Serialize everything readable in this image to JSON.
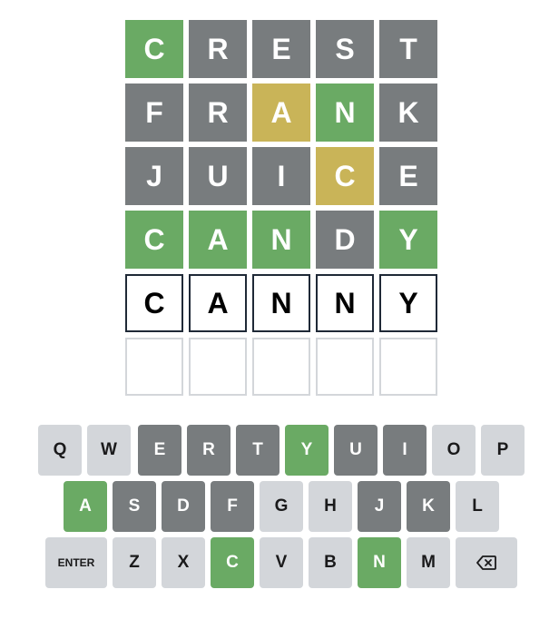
{
  "board": {
    "rows": [
      [
        {
          "letter": "C",
          "state": "correct"
        },
        {
          "letter": "R",
          "state": "absent"
        },
        {
          "letter": "E",
          "state": "absent"
        },
        {
          "letter": "S",
          "state": "absent"
        },
        {
          "letter": "T",
          "state": "absent"
        }
      ],
      [
        {
          "letter": "F",
          "state": "absent"
        },
        {
          "letter": "R",
          "state": "absent"
        },
        {
          "letter": "A",
          "state": "present"
        },
        {
          "letter": "N",
          "state": "correct"
        },
        {
          "letter": "K",
          "state": "absent"
        }
      ],
      [
        {
          "letter": "J",
          "state": "absent"
        },
        {
          "letter": "U",
          "state": "absent"
        },
        {
          "letter": "I",
          "state": "absent"
        },
        {
          "letter": "C",
          "state": "present"
        },
        {
          "letter": "E",
          "state": "absent"
        }
      ],
      [
        {
          "letter": "C",
          "state": "correct"
        },
        {
          "letter": "A",
          "state": "correct"
        },
        {
          "letter": "N",
          "state": "correct"
        },
        {
          "letter": "D",
          "state": "absent"
        },
        {
          "letter": "Y",
          "state": "correct"
        }
      ],
      [
        {
          "letter": "C",
          "state": "tbd"
        },
        {
          "letter": "A",
          "state": "tbd"
        },
        {
          "letter": "N",
          "state": "tbd"
        },
        {
          "letter": "N",
          "state": "tbd"
        },
        {
          "letter": "Y",
          "state": "tbd"
        }
      ],
      [
        {
          "letter": "",
          "state": "empty"
        },
        {
          "letter": "",
          "state": "empty"
        },
        {
          "letter": "",
          "state": "empty"
        },
        {
          "letter": "",
          "state": "empty"
        },
        {
          "letter": "",
          "state": "empty"
        }
      ]
    ]
  },
  "keyboard": {
    "rows": [
      [
        {
          "label": "Q",
          "state": "default"
        },
        {
          "label": "W",
          "state": "default"
        },
        {
          "label": "E",
          "state": "absent"
        },
        {
          "label": "R",
          "state": "absent"
        },
        {
          "label": "T",
          "state": "absent"
        },
        {
          "label": "Y",
          "state": "correct"
        },
        {
          "label": "U",
          "state": "absent"
        },
        {
          "label": "I",
          "state": "absent"
        },
        {
          "label": "O",
          "state": "default"
        },
        {
          "label": "P",
          "state": "default"
        }
      ],
      [
        {
          "label": "A",
          "state": "correct"
        },
        {
          "label": "S",
          "state": "absent"
        },
        {
          "label": "D",
          "state": "absent"
        },
        {
          "label": "F",
          "state": "absent"
        },
        {
          "label": "G",
          "state": "default"
        },
        {
          "label": "H",
          "state": "default"
        },
        {
          "label": "J",
          "state": "absent"
        },
        {
          "label": "K",
          "state": "absent"
        },
        {
          "label": "L",
          "state": "default"
        }
      ],
      [
        {
          "label": "ENTER",
          "state": "default",
          "kind": "enter"
        },
        {
          "label": "Z",
          "state": "default"
        },
        {
          "label": "X",
          "state": "default"
        },
        {
          "label": "C",
          "state": "correct"
        },
        {
          "label": "V",
          "state": "default"
        },
        {
          "label": "B",
          "state": "default"
        },
        {
          "label": "N",
          "state": "correct"
        },
        {
          "label": "M",
          "state": "default"
        },
        {
          "label": "",
          "state": "default",
          "kind": "backspace",
          "icon": "backspace-icon"
        }
      ]
    ]
  },
  "colors": {
    "correct": "#6aaa64",
    "present": "#c9b458",
    "absent": "#787c7e",
    "key_default": "#d3d6da",
    "empty_border": "#d3d6da",
    "tbd_border": "#1f2937"
  }
}
